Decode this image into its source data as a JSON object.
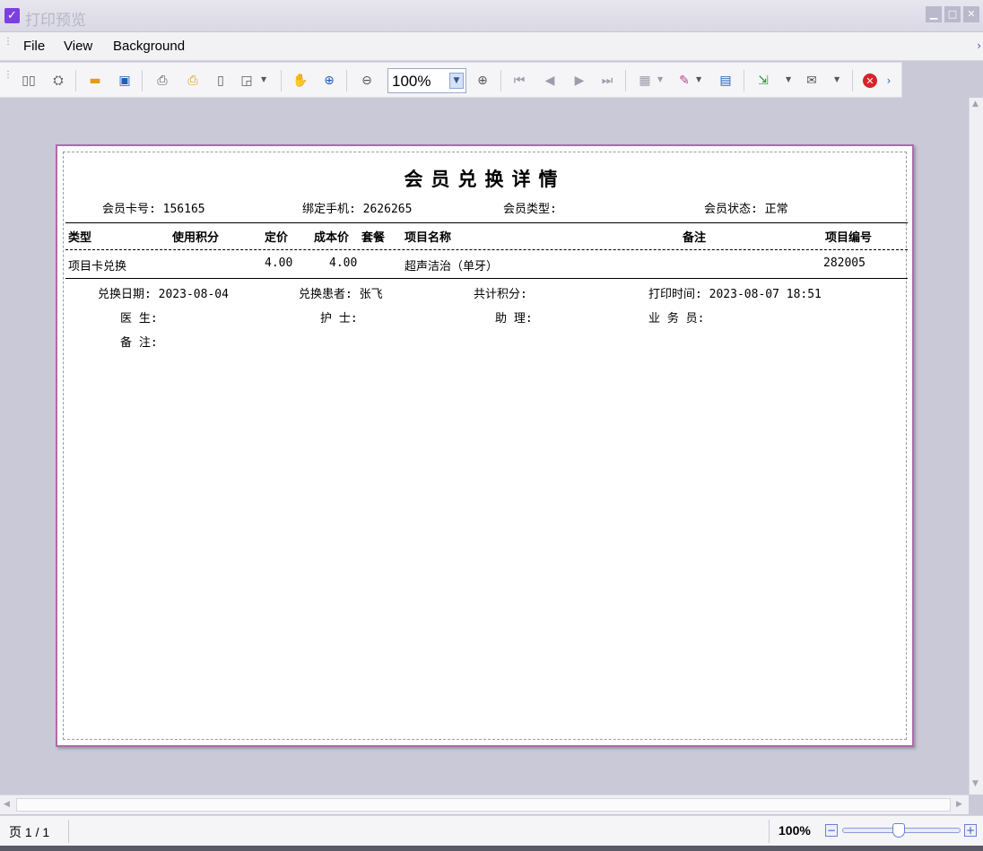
{
  "window": {
    "title": "打印预览",
    "controls": [
      "minimize-icon",
      "maximize-icon",
      "close-icon"
    ]
  },
  "menu": {
    "items": [
      "File",
      "View",
      "Background"
    ]
  },
  "toolbar": {
    "zoom_value": "100%",
    "icons": [
      "thumbnails-icon",
      "find-icon",
      "open-icon",
      "save-icon",
      "print-icon",
      "quick-print-icon",
      "page-setup-icon",
      "scale-icon",
      "hand-tool-icon",
      "magnifier-icon",
      "zoom-out-icon",
      "zoom-in-icon",
      "first-page-icon",
      "previous-page-icon",
      "next-page-icon",
      "last-page-icon",
      "multiple-pages-icon",
      "background-color-icon",
      "watermark-icon",
      "export-icon",
      "email-icon",
      "close-preview-icon"
    ]
  },
  "report": {
    "title": "会员兑换详情",
    "info": {
      "card_no": "会员卡号: 156165",
      "phone": "绑定手机: 2626265",
      "member_type": "会员类型:",
      "member_status": "会员状态: 正常"
    },
    "table": {
      "headers": [
        "类型",
        "使用积分",
        "定价",
        "成本价",
        "套餐",
        "项目名称",
        "备注",
        "项目编号"
      ],
      "rows": [
        {
          "type": "项目卡兑换",
          "points": "",
          "price": "4.00",
          "cost": "4.00",
          "package": "",
          "item_name": "超声洁治（单牙）",
          "note": "",
          "item_no": "282005"
        }
      ]
    },
    "footer": {
      "exchange_date": "兑换日期: 2023-08-04",
      "patient": "兑换患者: 张飞",
      "total_points": "共计积分:",
      "print_time": "打印时间: 2023-08-07 18:51",
      "doctor": "医 生:",
      "nurse": "护 士:",
      "assistant": "助 理:",
      "salesperson": "业 务 员:",
      "remark": "备 注:"
    }
  },
  "status": {
    "page": "页 1 / 1",
    "zoom": "100%"
  }
}
